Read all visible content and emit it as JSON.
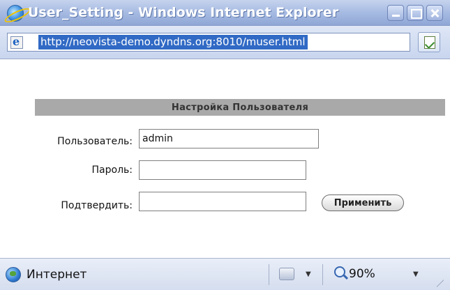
{
  "window": {
    "title": "User_Setting - Windows Internet Explorer"
  },
  "address_bar": {
    "url": "http://neovista-demo.dyndns.org:8010/muser.html"
  },
  "form": {
    "header": "Настройка Пользователя",
    "user_label": "Пользователь:",
    "user_value": "admin",
    "password_label": "Пароль:",
    "password_value": "",
    "confirm_label": "Подтвердить:",
    "confirm_value": "",
    "apply_label": "Применить"
  },
  "status_bar": {
    "zone": "Интернет",
    "zoom": "90%"
  },
  "icons": {
    "app": "internet-explorer-icon",
    "page": "page-icon",
    "compat": "compatibility-view-icon",
    "zone": "globe-icon",
    "security": "protected-mode-icon",
    "zoom": "magnifier-icon"
  }
}
